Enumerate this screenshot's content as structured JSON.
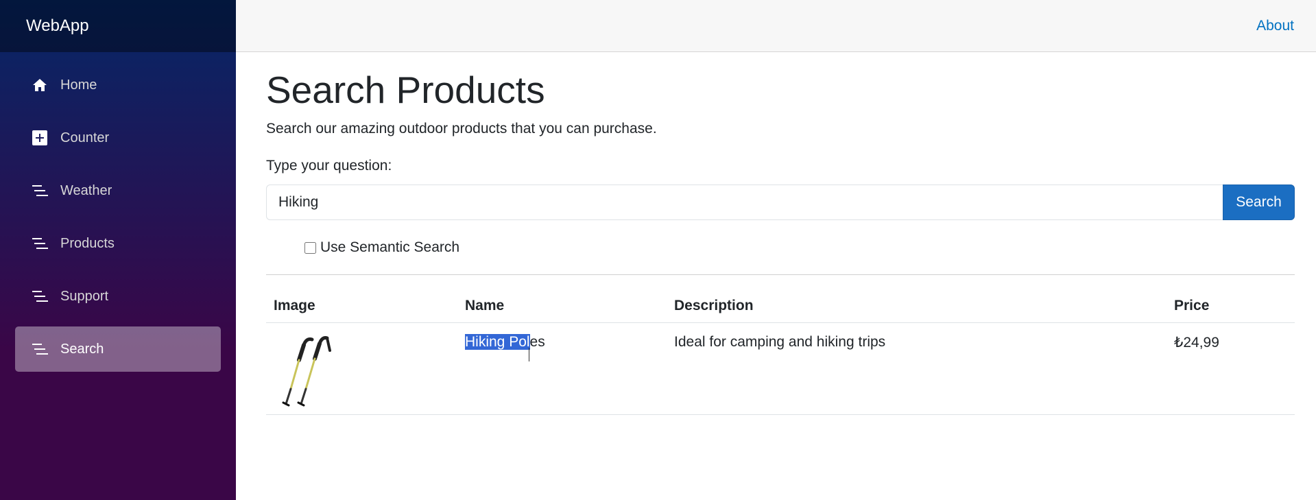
{
  "sidebar": {
    "brand": "WebApp",
    "items": [
      {
        "label": "Home",
        "icon": "home-icon"
      },
      {
        "label": "Counter",
        "icon": "plus-square-icon"
      },
      {
        "label": "Weather",
        "icon": "list-icon"
      },
      {
        "label": "Products",
        "icon": "list-icon"
      },
      {
        "label": "Support",
        "icon": "list-icon"
      },
      {
        "label": "Search",
        "icon": "list-icon",
        "active": true
      }
    ]
  },
  "topbar": {
    "about": "About"
  },
  "main": {
    "title": "Search Products",
    "subtitle": "Search our amazing outdoor products that you can purchase.",
    "question_label": "Type your question:",
    "search_value": "Hiking",
    "search_button": "Search",
    "semantic_label": "Use Semantic Search",
    "semantic_checked": false
  },
  "table": {
    "headers": [
      "Image",
      "Name",
      "Description",
      "Price"
    ],
    "rows": [
      {
        "name_selected": "Hiking Pol",
        "name_rest": "es",
        "description": "Ideal for camping and hiking trips",
        "price": "₺24,99"
      }
    ]
  },
  "colors": {
    "accent": "#1b6ec2",
    "link": "#0071c1",
    "sidebar_top": "#052767",
    "sidebar_bottom": "#3a0647",
    "selection": "#3367d6"
  }
}
